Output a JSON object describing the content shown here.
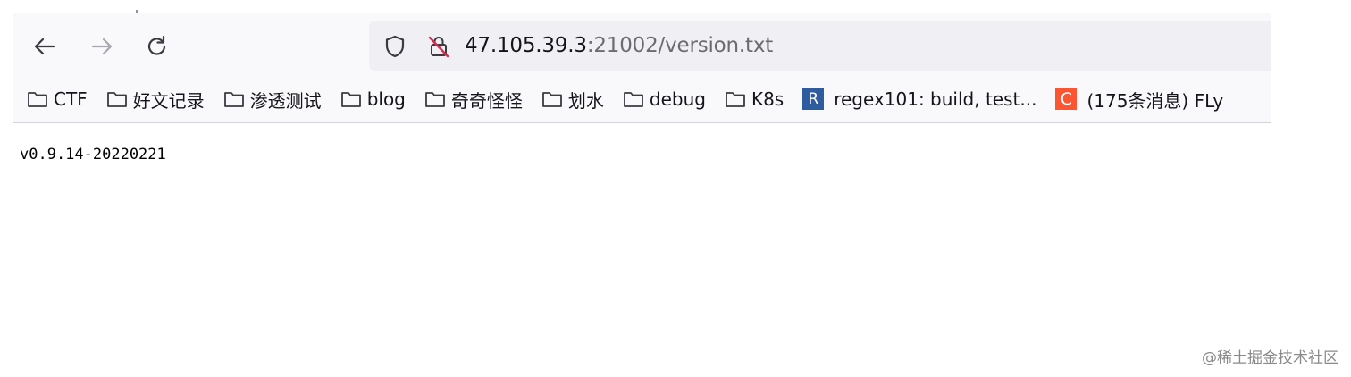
{
  "toolbar": {
    "url_host": "47.105.39.3",
    "url_rest": ":21002/version.txt"
  },
  "bookmarks": [
    {
      "label": "CTF",
      "icon": "folder-icon"
    },
    {
      "label": "好文记录",
      "icon": "folder-icon"
    },
    {
      "label": "渗透测试",
      "icon": "folder-icon"
    },
    {
      "label": "blog",
      "icon": "folder-icon"
    },
    {
      "label": "奇奇怪怪",
      "icon": "folder-icon"
    },
    {
      "label": "划水",
      "icon": "folder-icon"
    },
    {
      "label": "debug",
      "icon": "folder-icon"
    },
    {
      "label": "K8s",
      "icon": "folder-icon"
    },
    {
      "label": "regex101: build, test...",
      "icon": "regex101-favicon",
      "favicon_text": "R",
      "favicon_color": "#2f5c9e"
    },
    {
      "label": "(175条消息) FLy",
      "icon": "csdn-favicon",
      "favicon_text": "C",
      "favicon_color": "#fc5531"
    }
  ],
  "page": {
    "content": "v0.9.14-20220221"
  },
  "watermark": "@稀土掘金技术社区"
}
